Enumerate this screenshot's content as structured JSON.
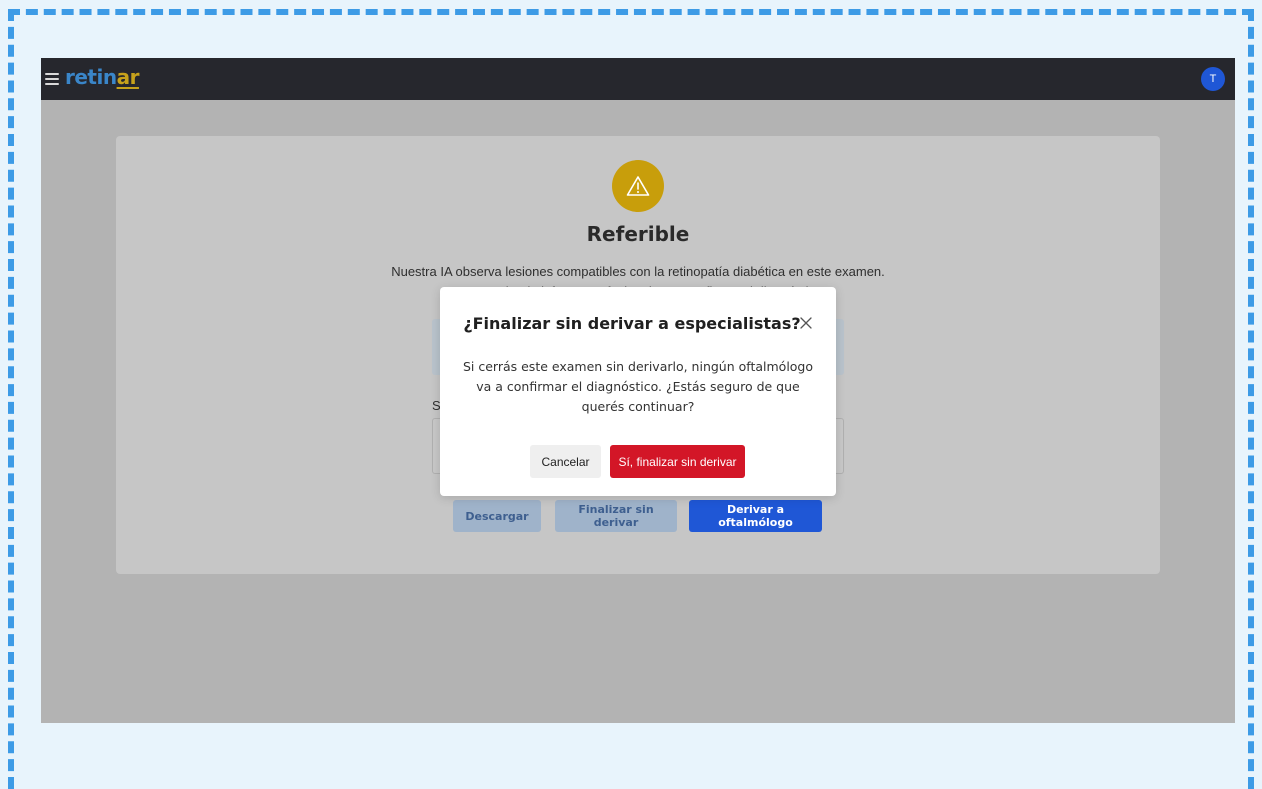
{
  "app": {
    "logo_part1": "retin",
    "logo_part2": "ar",
    "user_initial": "T",
    "colors": {
      "brand_blue": "#3a86c9",
      "brand_gold": "#c7a21b",
      "topbar": "#26272d",
      "primary": "#1f57d6",
      "danger": "#d31627",
      "warning": "#c89e0b"
    }
  },
  "card": {
    "icon": "warning-triangle-icon",
    "title": "Referible",
    "description_line1": "Nuestra IA observa lesiones compatibles con la retinopatía diabética en este examen.",
    "description_line2": "Se recomienda informe profesional para confirmar el diagnóstico.",
    "field_label": "S",
    "actions": {
      "download": "Descargar",
      "finish_without_referral": "Finalizar sin derivar",
      "refer": "Derivar a oftalmólogo"
    }
  },
  "modal": {
    "title": "¿Finalizar sin derivar a especialistas?",
    "body": "Si cerrás este examen sin derivarlo, ningún oftalmólogo va a confirmar el diagnóstico. ¿Estás seguro de que querés continuar?",
    "cancel": "Cancelar",
    "confirm": "Sí, finalizar sin derivar"
  }
}
